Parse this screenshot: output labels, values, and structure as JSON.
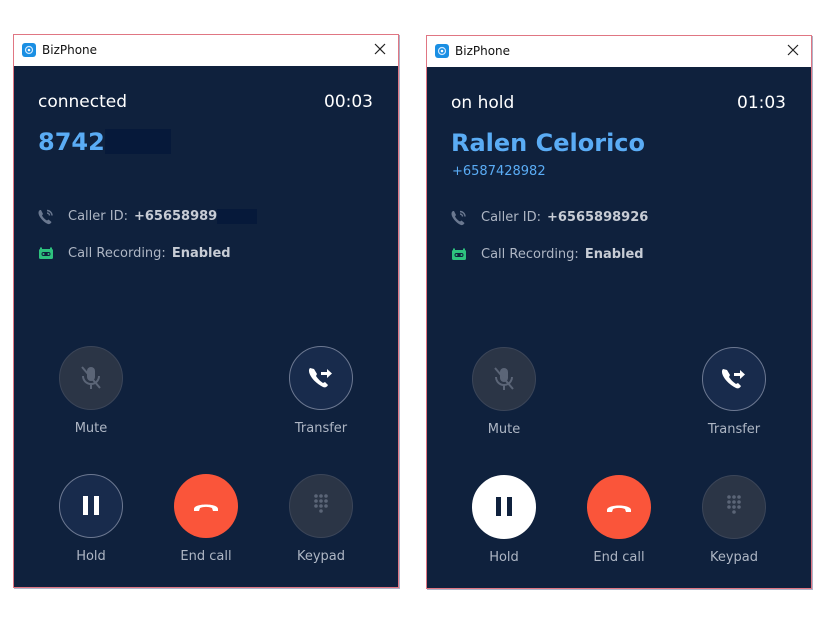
{
  "windows": [
    {
      "title": "BizPhone",
      "status": "connected",
      "timer": "00:03",
      "caller_name": "8742",
      "caller_number": "",
      "caller_id_label": "Caller ID:",
      "caller_id_value": "+65658989",
      "recording_label": "Call Recording:",
      "recording_value": "Enabled",
      "buttons": {
        "mute": {
          "label": "Mute",
          "state": "disabled"
        },
        "transfer": {
          "label": "Transfer",
          "state": "enabled"
        },
        "hold": {
          "label": "Hold",
          "state": "off"
        },
        "end_call": {
          "label": "End call"
        },
        "keypad": {
          "label": "Keypad",
          "state": "disabled"
        }
      }
    },
    {
      "title": "BizPhone",
      "status": "on hold",
      "timer": "01:03",
      "caller_name": "Ralen Celorico",
      "caller_number": "+6587428982",
      "caller_id_label": "Caller ID:",
      "caller_id_value": "+6565898926",
      "recording_label": "Call Recording:",
      "recording_value": "Enabled",
      "buttons": {
        "mute": {
          "label": "Mute",
          "state": "disabled"
        },
        "transfer": {
          "label": "Transfer",
          "state": "enabled"
        },
        "hold": {
          "label": "Hold",
          "state": "active"
        },
        "end_call": {
          "label": "End call"
        },
        "keypad": {
          "label": "Keypad",
          "state": "disabled"
        }
      }
    }
  ],
  "colors": {
    "background": "#0f213d",
    "accent_blue": "#5aacf5",
    "end_call_red": "#fa553a",
    "recording_green": "#2ec27e",
    "window_border": "#e07683"
  },
  "icons": {
    "app": "phone-app-icon",
    "close": "close-icon",
    "caller_id": "phone-ringing-icon",
    "recording": "cassette-recording-icon",
    "mute": "microphone-off-icon",
    "transfer": "phone-transfer-icon",
    "hold": "pause-icon",
    "end_call": "hang-up-icon",
    "keypad": "dialpad-icon"
  }
}
